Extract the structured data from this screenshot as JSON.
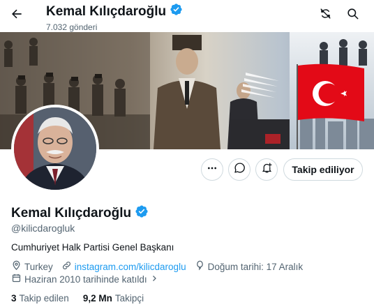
{
  "header": {
    "title": "Kemal Kılıçdaroğlu",
    "post_count": "7.032 gönderi"
  },
  "profile": {
    "name": "Kemal Kılıçdaroğlu",
    "handle": "@kilicdarogluk",
    "bio": "Cumhuriyet Halk Partisi Genel Başkanı",
    "location": "Turkey",
    "website": "instagram.com/kilicdaroglu",
    "birthday": "Doğum tarihi: 17 Aralık",
    "joined": "Haziran 2010 tarihinde katıldı",
    "following_count": "3",
    "following_label": "Takip edilen",
    "followers_count": "9,2 Mn",
    "followers_label": "Takipçi"
  },
  "actions": {
    "follow_label": "Takip ediliyor"
  },
  "icons": {
    "back": "arrow-left-icon",
    "refresh": "refresh-icon",
    "search": "search-icon",
    "more": "more-icon",
    "message": "message-icon",
    "notify": "bell-plus-icon",
    "verified": "verified-badge-icon",
    "location": "location-pin-icon",
    "link": "link-icon",
    "birthday": "balloon-icon",
    "calendar": "calendar-icon"
  },
  "colors": {
    "accent": "#1d9bf0",
    "text_primary": "#0f1419",
    "text_secondary": "#536471",
    "border": "#cfd9de",
    "flag_red": "#e30a17"
  }
}
